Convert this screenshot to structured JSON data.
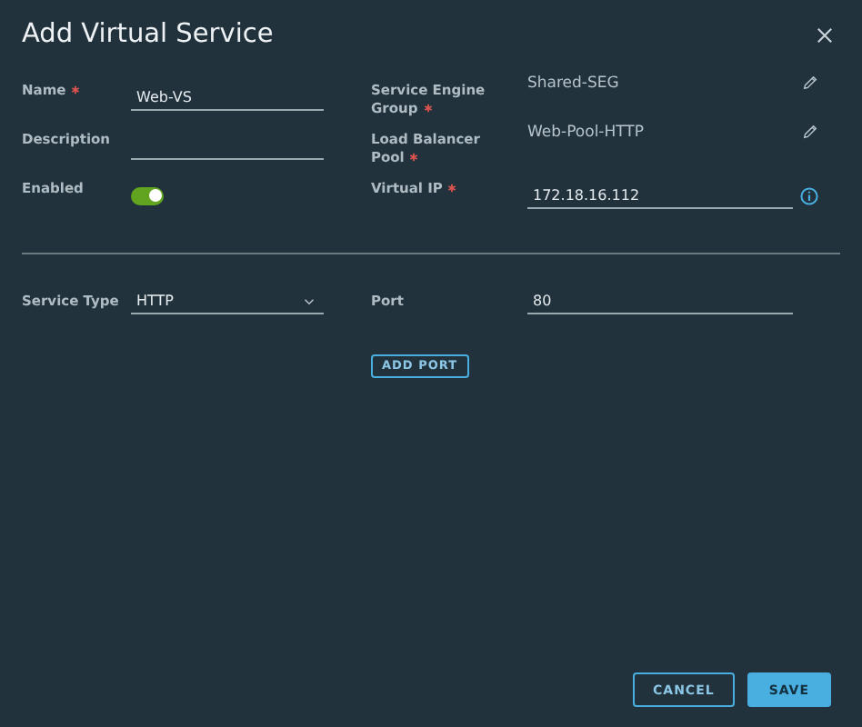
{
  "dialog": {
    "title": "Add Virtual Service"
  },
  "rows": [
    {
      "left": {
        "kind": "text",
        "label": "Name",
        "required": true,
        "value": "Web-VS"
      },
      "right": {
        "kind": "readonly",
        "label": "Service Engine Group",
        "required": true,
        "value": "Shared-SEG",
        "edit_icon": true
      }
    },
    {
      "left": {
        "kind": "text",
        "label": "Description",
        "required": false
      },
      "right": {
        "kind": "readonly",
        "label": "Load Balancer Pool",
        "required": true,
        "value": "Web-Pool-HTTP",
        "edit_icon": true
      }
    },
    {
      "left": {
        "kind": "toggle",
        "label": "Enabled",
        "required": false,
        "on": true
      },
      "right": {
        "kind": "text",
        "label": "Virtual IP",
        "required": true,
        "value": "172.18.16.112",
        "info_icon": true
      }
    }
  ],
  "port_row": {
    "service_type": {
      "label": "Service Type",
      "value": "HTTP"
    },
    "port": {
      "label": "Port",
      "value": "80"
    }
  },
  "add_port_button": "ADD PORT",
  "footer_buttons": [
    {
      "label": "CANCEL",
      "kind": "outline"
    },
    {
      "label": "SAVE",
      "kind": "primary"
    }
  ]
}
